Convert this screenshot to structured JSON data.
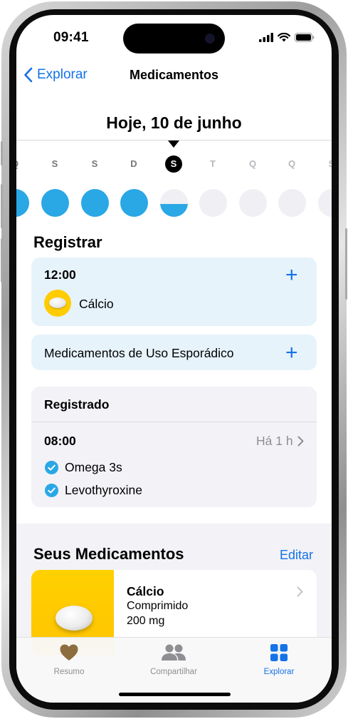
{
  "status": {
    "time": "09:41"
  },
  "nav": {
    "back_label": "Explorar",
    "title": "Medicamentos"
  },
  "date_title": "Hoje, 10 de junho",
  "days": [
    {
      "letter": "Q",
      "state": "full"
    },
    {
      "letter": "S",
      "state": "full"
    },
    {
      "letter": "S",
      "state": "full"
    },
    {
      "letter": "D",
      "state": "full"
    },
    {
      "letter": "S",
      "state": "half",
      "today": true,
      "progress": 0.5
    },
    {
      "letter": "T",
      "state": "empty"
    },
    {
      "letter": "Q",
      "state": "empty"
    },
    {
      "letter": "Q",
      "state": "empty"
    },
    {
      "letter": "S",
      "state": "empty"
    }
  ],
  "register": {
    "title": "Registrar",
    "scheduled_time": "12:00",
    "scheduled_med": "Cálcio",
    "sporadic_label": "Medicamentos de Uso Esporádico"
  },
  "logged": {
    "title": "Registrado",
    "time": "08:00",
    "ago": "Há 1 h",
    "meds": [
      "Omega 3s",
      "Levothyroxine"
    ]
  },
  "your_meds": {
    "title": "Seus Medicamentos",
    "edit_label": "Editar",
    "item": {
      "name": "Cálcio",
      "form": "Comprimido",
      "dose": "200 mg"
    }
  },
  "tabs": [
    {
      "label": "Resumo",
      "icon": "heart-icon"
    },
    {
      "label": "Compartilhar",
      "icon": "people-icon"
    },
    {
      "label": "Explorar",
      "icon": "grid-icon",
      "active": true
    }
  ],
  "colors": {
    "accent": "#1473e6",
    "progress": "#2aa7e5",
    "register_bg": "#e6f3fb",
    "card_gray": "#f2f2f7",
    "med_yellow": "#ffcc00"
  }
}
